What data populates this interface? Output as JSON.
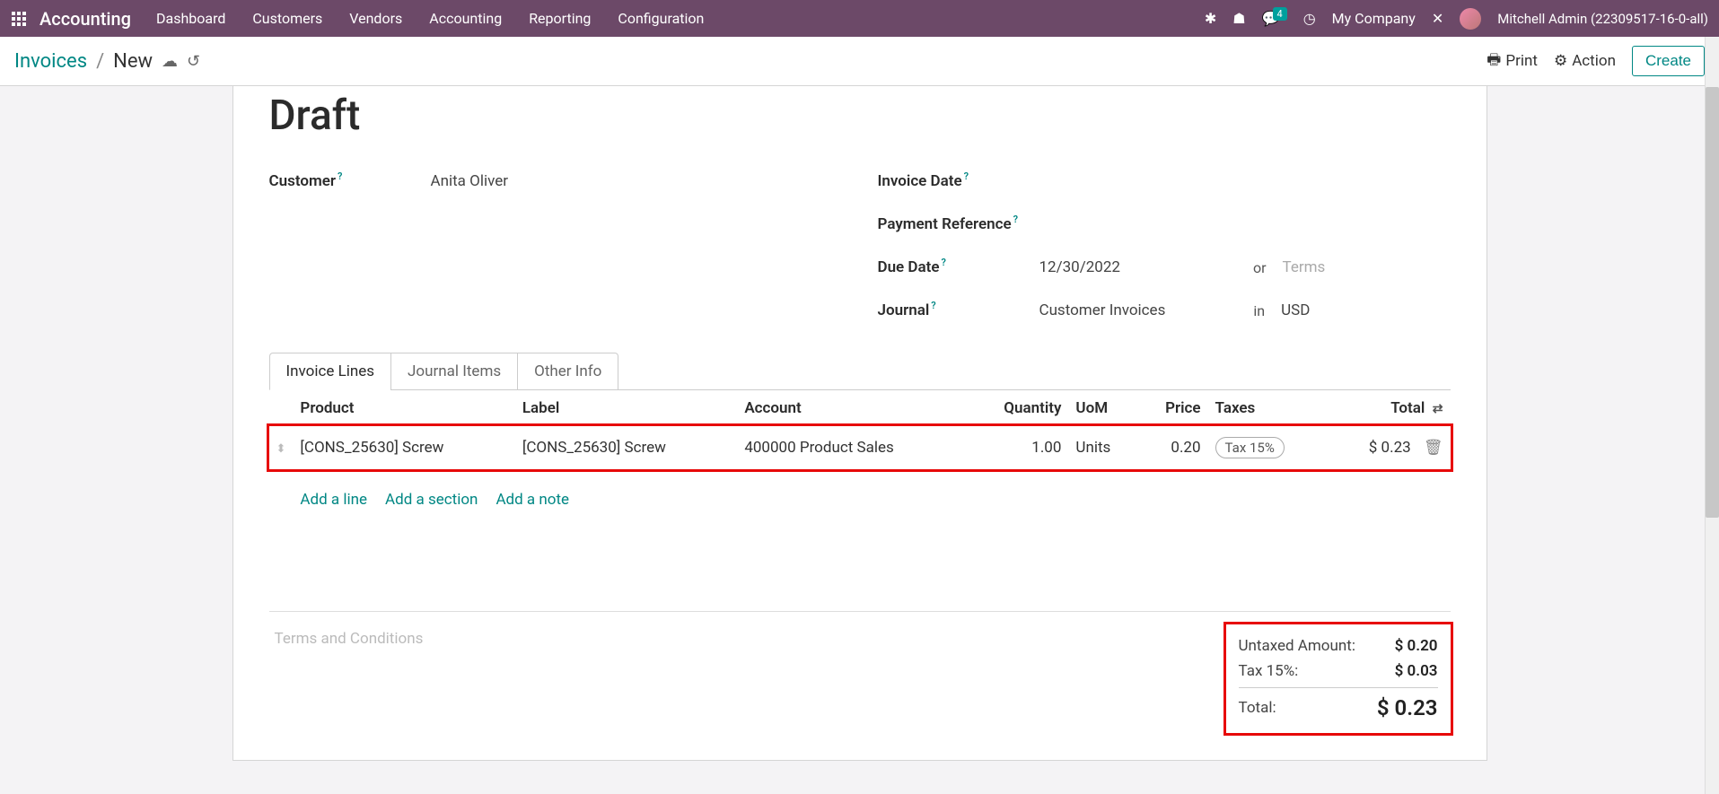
{
  "nav": {
    "brand": "Accounting",
    "menu": [
      "Dashboard",
      "Customers",
      "Vendors",
      "Accounting",
      "Reporting",
      "Configuration"
    ],
    "chat_badge": "4",
    "company": "My Company",
    "user": "Mitchell Admin (22309517-16-0-all)"
  },
  "breadcrumb": {
    "root": "Invoices",
    "current": "New",
    "print": "Print",
    "action": "Action",
    "create": "Create"
  },
  "form": {
    "status": "Draft",
    "left": {
      "customer_label": "Customer",
      "customer_value": "Anita Oliver"
    },
    "right": {
      "invoice_date_label": "Invoice Date",
      "payment_ref_label": "Payment Reference",
      "due_date_label": "Due Date",
      "due_date_value": "12/30/2022",
      "due_or": "or",
      "terms_placeholder": "Terms",
      "journal_label": "Journal",
      "journal_value": "Customer Invoices",
      "journal_in": "in",
      "journal_currency": "USD"
    }
  },
  "tabs": [
    "Invoice Lines",
    "Journal Items",
    "Other Info"
  ],
  "table": {
    "headers": {
      "product": "Product",
      "label": "Label",
      "account": "Account",
      "quantity": "Quantity",
      "uom": "UoM",
      "price": "Price",
      "taxes": "Taxes",
      "total": "Total"
    },
    "row": {
      "product": "[CONS_25630] Screw",
      "label": "[CONS_25630] Screw",
      "account": "400000 Product Sales",
      "quantity": "1.00",
      "uom": "Units",
      "price": "0.20",
      "tax": "Tax 15%",
      "total": "$ 0.23"
    },
    "add_line": "Add a line",
    "add_section": "Add a section",
    "add_note": "Add a note"
  },
  "footer": {
    "terms_placeholder": "Terms and Conditions",
    "untaxed_label": "Untaxed Amount:",
    "untaxed_value": "$ 0.20",
    "tax_label": "Tax 15%:",
    "tax_value": "$ 0.03",
    "total_label": "Total:",
    "total_value": "$ 0.23"
  }
}
